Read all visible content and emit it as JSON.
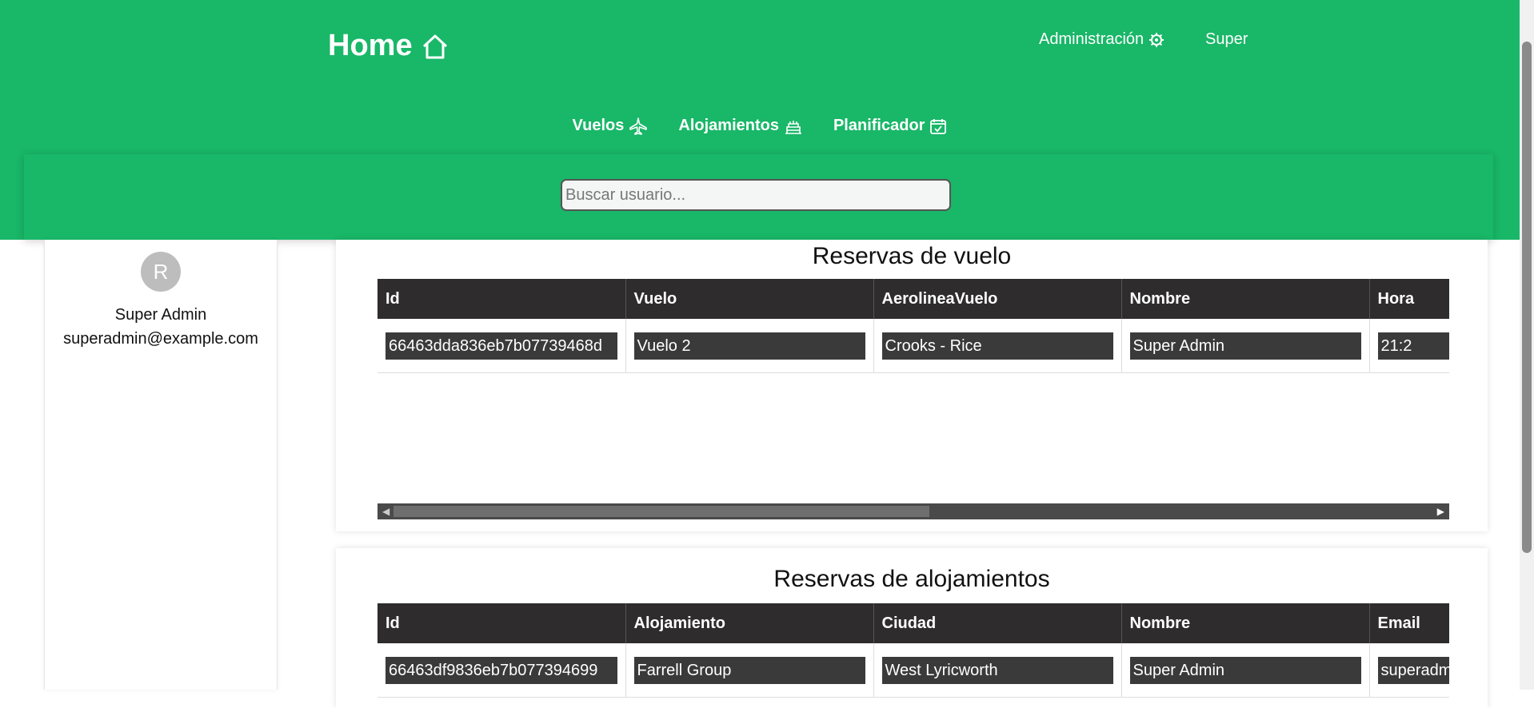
{
  "header": {
    "brand": "Home",
    "admin_label": "Administración",
    "user_label": "Super",
    "nav": [
      {
        "label": "Vuelos",
        "icon": "airplane-icon"
      },
      {
        "label": "Alojamientos",
        "icon": "hotel-icon"
      },
      {
        "label": "Planificador",
        "icon": "calendar-check-icon"
      }
    ],
    "search_placeholder": "Buscar usuario..."
  },
  "sidebar": {
    "avatar_initial": "R",
    "name": "Super Admin",
    "email": "superadmin@example.com"
  },
  "flights": {
    "title": "Reservas de vuelo",
    "columns": [
      "Id",
      "Vuelo",
      "AerolineaVuelo",
      "Nombre",
      "Hora"
    ],
    "rows": [
      [
        "66463dda836eb7b07739468d",
        "Vuelo 2",
        "Crooks - Rice",
        "Super Admin",
        "21:2"
      ]
    ]
  },
  "lodging": {
    "title": "Reservas de alojamientos",
    "columns": [
      "Id",
      "Alojamiento",
      "Ciudad",
      "Nombre",
      "Email"
    ],
    "rows": [
      [
        "66463df9836eb7b077394699",
        "Farrell Group",
        "West Lyricworth",
        "Super Admin",
        "superadm"
      ]
    ]
  },
  "colors": {
    "header_green": "#19b768",
    "table_header": "#2e2c2c",
    "cell_dark": "#3a3a3a"
  }
}
